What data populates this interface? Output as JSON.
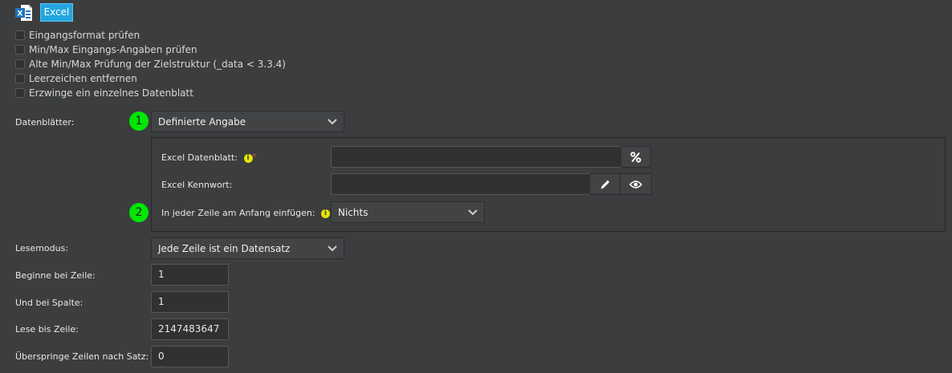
{
  "header": {
    "excel_icon": "excel-file-icon",
    "excel_button_label": "Excel"
  },
  "checkboxes": [
    {
      "label": "Eingangsformat prüfen",
      "checked": false
    },
    {
      "label": "Min/Max Eingangs-Angaben prüfen",
      "checked": false
    },
    {
      "label": "Alte Min/Max Prüfung der Zielstruktur (_data < 3.3.4)",
      "checked": false
    },
    {
      "label": "Leerzeichen entfernen",
      "checked": false
    },
    {
      "label": "Erzwinge ein einzelnes Datenblatt",
      "checked": false
    }
  ],
  "datenblaetter": {
    "label": "Datenblätter:",
    "badge": "1",
    "value": "Definierte Angabe"
  },
  "panel": {
    "excel_datenblatt": {
      "label": "Excel Datenblatt:",
      "info": "i",
      "required": "*",
      "value": ""
    },
    "excel_kennwort": {
      "label": "Excel Kennwort:",
      "value": ""
    },
    "zeile_anfang": {
      "label": "In jeder Zeile am Anfang einfügen:",
      "info": "i",
      "badge": "2",
      "value": "Nichts"
    }
  },
  "lesemodus": {
    "label": "Lesemodus:",
    "value": "Jede Zeile ist ein Datensatz"
  },
  "fields": {
    "beginne_zeile": {
      "label": "Beginne bei Zeile:",
      "value": "1"
    },
    "und_spalte": {
      "label": "Und bei Spalte:",
      "value": "1"
    },
    "lese_bis": {
      "label": "Lese bis Zeile:",
      "value": "2147483647"
    },
    "ueberspringe": {
      "label": "Überspringe Zeilen nach Satz:",
      "value": "0"
    }
  },
  "colors": {
    "background": "#3b3d3e",
    "accent_button": "#23a5df",
    "badge_green": "#00e600",
    "info_yellow": "#e6e600",
    "required_red": "#d9534f"
  }
}
